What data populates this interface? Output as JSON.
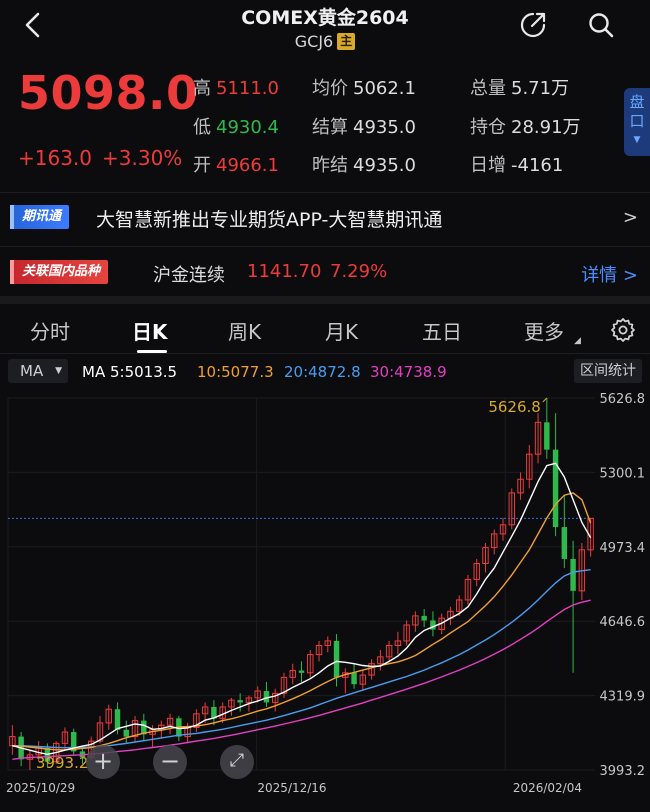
{
  "header": {
    "title": "COMEX黄金2604",
    "subtitle": "GCJ6",
    "badge": "主"
  },
  "quote": {
    "price": "5098.0",
    "change": "+163.0",
    "change_pct": "+3.30%",
    "high_label": "高",
    "high": "5111.0",
    "low_label": "低",
    "low": "4930.4",
    "open_label": "开",
    "open": "4966.1",
    "avg_label": "均价",
    "avg": "5062.1",
    "settle_label": "结算",
    "settle": "4935.0",
    "prev_settle_label": "昨结",
    "prev_settle": "4935.0",
    "volume_label": "总量",
    "volume": "5.71万",
    "oi_label": "持仓",
    "oi": "28.91万",
    "oi_change_label": "日增",
    "oi_change": "-4161",
    "pankou_label_1": "盘",
    "pankou_label_2": "口"
  },
  "news": {
    "tag": "期讯通",
    "text": "大智慧新推出专业期货APP-大智慧期讯通"
  },
  "related": {
    "tag": "关联国内品种",
    "name": "沪金连续",
    "price": "1141.70",
    "pct": "7.29%",
    "details": "详情 >"
  },
  "tabs": [
    "分时",
    "日K",
    "周K",
    "月K",
    "五日",
    "更多"
  ],
  "active_tab": "日K",
  "ma_bar": {
    "select": "MA",
    "ma5": "MA 5:5013.5",
    "ma10": "10:5077.3",
    "ma20": "20:4872.8",
    "ma30": "30:4738.9",
    "interval_stats": "区间统计"
  },
  "colors": {
    "up": "#ec3b3b",
    "down": "#2fb84c",
    "ma5": "#ffffff",
    "ma10": "#f0a030",
    "ma20": "#4a9cf0",
    "ma30": "#e040c0",
    "accent": "#4a8dff"
  },
  "chart_data": {
    "type": "candlestick",
    "y_ticks": [
      "5626.8",
      "5300.1",
      "4973.4",
      "4646.6",
      "4319.9",
      "3993.2"
    ],
    "ylim": [
      3993.2,
      5626.8
    ],
    "x_labels": [
      "2025/10/29",
      "2025/12/16",
      "2026/02/04"
    ],
    "max_label": "5626.8",
    "min_label": "3993.2",
    "current_price": 5098.0,
    "candles": [
      [
        4100,
        4190,
        4060,
        4140
      ],
      [
        4140,
        4160,
        4010,
        4040
      ],
      [
        4040,
        4080,
        3993.2,
        4060
      ],
      [
        4060,
        4120,
        4030,
        4090
      ],
      [
        4090,
        4110,
        4010,
        4030
      ],
      [
        4030,
        4120,
        4020,
        4110
      ],
      [
        4110,
        4180,
        4080,
        4160
      ],
      [
        4160,
        4175,
        4060,
        4075
      ],
      [
        4075,
        4100,
        4020,
        4050
      ],
      [
        4050,
        4140,
        4040,
        4120
      ],
      [
        4120,
        4230,
        4110,
        4200
      ],
      [
        4200,
        4280,
        4170,
        4260
      ],
      [
        4260,
        4290,
        4150,
        4170
      ],
      [
        4170,
        4210,
        4110,
        4140
      ],
      [
        4140,
        4230,
        4120,
        4210
      ],
      [
        4210,
        4240,
        4120,
        4150
      ],
      [
        4150,
        4190,
        4090,
        4170
      ],
      [
        4170,
        4210,
        4130,
        4190
      ],
      [
        4190,
        4240,
        4150,
        4220
      ],
      [
        4220,
        4230,
        4120,
        4140
      ],
      [
        4140,
        4200,
        4110,
        4180
      ],
      [
        4180,
        4260,
        4160,
        4240
      ],
      [
        4240,
        4290,
        4200,
        4270
      ],
      [
        4270,
        4300,
        4190,
        4220
      ],
      [
        4220,
        4290,
        4200,
        4270
      ],
      [
        4270,
        4310,
        4230,
        4300
      ],
      [
        4300,
        4330,
        4250,
        4290
      ],
      [
        4290,
        4320,
        4250,
        4310
      ],
      [
        4310,
        4360,
        4290,
        4340
      ],
      [
        4340,
        4380,
        4270,
        4290
      ],
      [
        4290,
        4350,
        4250,
        4330
      ],
      [
        4330,
        4420,
        4310,
        4400
      ],
      [
        4400,
        4460,
        4370,
        4430
      ],
      [
        4430,
        4470,
        4380,
        4420
      ],
      [
        4420,
        4520,
        4400,
        4500
      ],
      [
        4500,
        4560,
        4470,
        4540
      ],
      [
        4540,
        4580,
        4510,
        4560
      ],
      [
        4560,
        4590,
        4360,
        4400
      ],
      [
        4400,
        4440,
        4330,
        4420
      ],
      [
        4420,
        4460,
        4350,
        4370
      ],
      [
        4370,
        4430,
        4340,
        4410
      ],
      [
        4410,
        4480,
        4390,
        4460
      ],
      [
        4460,
        4520,
        4430,
        4490
      ],
      [
        4490,
        4560,
        4470,
        4540
      ],
      [
        4540,
        4600,
        4500,
        4560
      ],
      [
        4560,
        4650,
        4540,
        4630
      ],
      [
        4630,
        4690,
        4600,
        4670
      ],
      [
        4670,
        4700,
        4620,
        4650
      ],
      [
        4650,
        4690,
        4580,
        4610
      ],
      [
        4610,
        4680,
        4590,
        4660
      ],
      [
        4660,
        4710,
        4630,
        4690
      ],
      [
        4690,
        4760,
        4670,
        4740
      ],
      [
        4740,
        4850,
        4720,
        4830
      ],
      [
        4830,
        4920,
        4800,
        4900
      ],
      [
        4900,
        4990,
        4860,
        4970
      ],
      [
        4970,
        5050,
        4940,
        5030
      ],
      [
        5030,
        5100,
        5000,
        5070
      ],
      [
        5070,
        5230,
        5050,
        5210
      ],
      [
        5210,
        5300,
        5180,
        5270
      ],
      [
        5270,
        5420,
        5230,
        5380
      ],
      [
        5380,
        5560,
        5340,
        5520
      ],
      [
        5520,
        5626.8,
        5360,
        5400
      ],
      [
        5400,
        5560,
        5020,
        5060
      ],
      [
        5060,
        5200,
        4880,
        4920
      ],
      [
        4920,
        5000,
        4420,
        4780
      ],
      [
        4780,
        4990,
        4740,
        4960
      ],
      [
        4960,
        5100,
        4930,
        5098
      ]
    ],
    "ma5": [
      4100,
      4090,
      4080,
      4070,
      4062,
      4070,
      4080,
      4090,
      4098,
      4105,
      4125,
      4150,
      4175,
      4185,
      4195,
      4190,
      4172,
      4175,
      4185,
      4175,
      4178,
      4190,
      4212,
      4222,
      4238,
      4255,
      4270,
      4285,
      4296,
      4310,
      4318,
      4335,
      4356,
      4375,
      4394,
      4420,
      4450,
      4470,
      4466,
      4460,
      4452,
      4448,
      4450,
      4470,
      4494,
      4528,
      4576,
      4606,
      4622,
      4638,
      4660,
      4680,
      4710,
      4766,
      4830,
      4880,
      4950,
      5020,
      5090,
      5175,
      5260,
      5330,
      5340,
      5280,
      5180,
      5080,
      5013.5
    ],
    "ma10": [
      4100,
      4098,
      4094,
      4090,
      4085,
      4082,
      4082,
      4084,
      4088,
      4092,
      4100,
      4110,
      4122,
      4135,
      4145,
      4155,
      4162,
      4168,
      4175,
      4182,
      4184,
      4186,
      4192,
      4200,
      4210,
      4218,
      4228,
      4240,
      4252,
      4262,
      4275,
      4290,
      4306,
      4323,
      4342,
      4362,
      4382,
      4400,
      4412,
      4422,
      4432,
      4442,
      4452,
      4460,
      4468,
      4480,
      4496,
      4520,
      4545,
      4568,
      4595,
      4620,
      4645,
      4680,
      4715,
      4754,
      4800,
      4850,
      4905,
      4960,
      5030,
      5100,
      5160,
      5200,
      5210,
      5180,
      5077.3
    ],
    "ma20": [
      4100,
      4100,
      4098,
      4096,
      4094,
      4092,
      4091,
      4091,
      4092,
      4094,
      4096,
      4100,
      4105,
      4110,
      4116,
      4122,
      4128,
      4134,
      4140,
      4146,
      4150,
      4154,
      4160,
      4166,
      4172,
      4180,
      4188,
      4196,
      4204,
      4212,
      4222,
      4232,
      4243,
      4254,
      4266,
      4280,
      4294,
      4308,
      4320,
      4332,
      4344,
      4356,
      4368,
      4380,
      4392,
      4404,
      4418,
      4432,
      4448,
      4464,
      4482,
      4500,
      4520,
      4542,
      4564,
      4588,
      4614,
      4642,
      4672,
      4704,
      4740,
      4778,
      4815,
      4845,
      4862,
      4868,
      4872.8
    ],
    "ma30": [
      4040,
      4045,
      4048,
      4050,
      4052,
      4054,
      4056,
      4058,
      4060,
      4063,
      4066,
      4070,
      4074,
      4078,
      4082,
      4087,
      4092,
      4097,
      4102,
      4108,
      4114,
      4120,
      4126,
      4132,
      4139,
      4146,
      4154,
      4162,
      4170,
      4178,
      4186,
      4195,
      4204,
      4213,
      4223,
      4233,
      4244,
      4255,
      4266,
      4277,
      4288,
      4300,
      4312,
      4324,
      4336,
      4348,
      4361,
      4374,
      4388,
      4402,
      4417,
      4432,
      4448,
      4465,
      4483,
      4502,
      4522,
      4544,
      4567,
      4591,
      4617,
      4645,
      4672,
      4698,
      4718,
      4730,
      4738.9
    ]
  }
}
